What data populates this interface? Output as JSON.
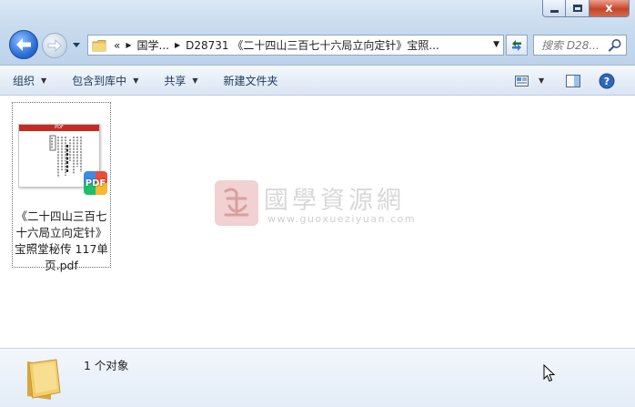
{
  "window": {
    "caption_close": "x"
  },
  "address_bar": {
    "overflow": "«",
    "crumbs": [
      "国学...",
      "D28731 《二十四山三百七十六局立向定针》宝照..."
    ]
  },
  "search": {
    "placeholder": "搜索 D28..."
  },
  "toolbar": {
    "organize": "组织",
    "include_in_library": "包含到库中",
    "share": "共享",
    "new_folder": "新建文件夹"
  },
  "file": {
    "name": "《二十四山三百七十六局立向定针》宝照堂秘传 117单页.pdf",
    "thumbnail_header": "PDF",
    "badge": "PDF"
  },
  "watermark": {
    "title": "國學資源網",
    "url": "www.guoxueziyuan.com"
  },
  "details": {
    "count_text": "1 个对象"
  }
}
